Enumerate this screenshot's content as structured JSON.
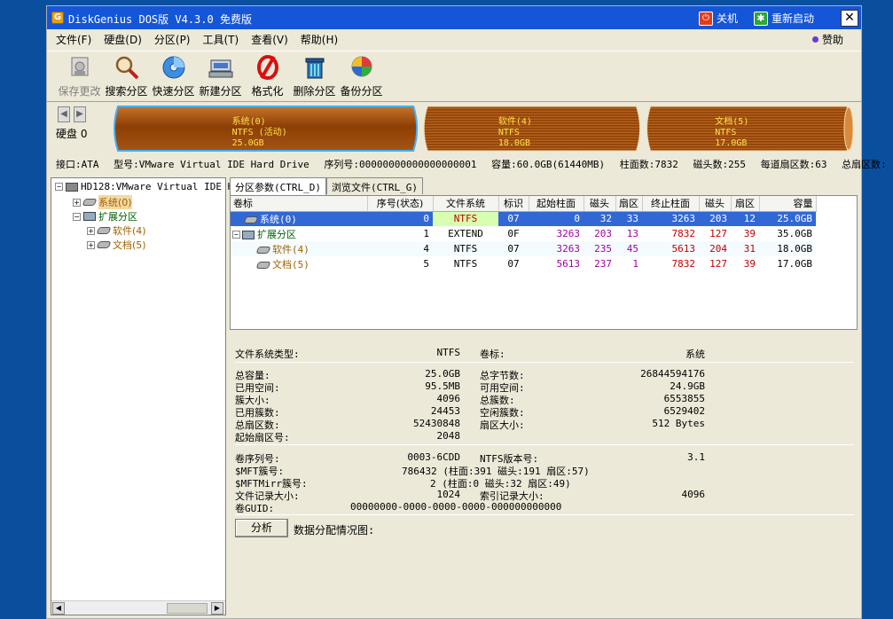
{
  "titlebar": {
    "title": "DiskGenius DOS版 V4.3.0 免费版",
    "app_icon": "G",
    "shutdown": "关机",
    "restart": "重新启动",
    "close": "✕"
  },
  "menu": [
    "文件(F)",
    "硬盘(D)",
    "分区(P)",
    "工具(T)",
    "查看(V)",
    "帮助(H)"
  ],
  "donate": "赞助",
  "toolbar": [
    {
      "label": "保存更改",
      "icon": "save-icon",
      "enabled": false
    },
    {
      "label": "搜索分区",
      "icon": "magnifier-icon",
      "enabled": true
    },
    {
      "label": "快速分区",
      "icon": "quick-partition-icon",
      "enabled": true
    },
    {
      "label": "新建分区",
      "icon": "new-partition-icon",
      "enabled": true
    },
    {
      "label": "格式化",
      "icon": "format-icon",
      "enabled": true
    },
    {
      "label": "删除分区",
      "icon": "trash-icon",
      "enabled": true
    },
    {
      "label": "备份分区",
      "icon": "backup-icon",
      "enabled": true
    }
  ],
  "disk": {
    "label": "硬盘 0",
    "partitions": [
      {
        "name": "系统(0)",
        "fs": "NTFS (活动)",
        "size": "25.0GB",
        "size_gb": 25.0
      },
      {
        "name": "软件(4)",
        "fs": "NTFS",
        "size": "18.0GB",
        "size_gb": 18.0
      },
      {
        "name": "文档(5)",
        "fs": "NTFS",
        "size": "17.0GB",
        "size_gb": 17.0
      }
    ]
  },
  "info": {
    "interface": "接口:ATA",
    "model": "型号:VMware Virtual IDE Hard Drive",
    "serial": "序列号:00000000000000000001",
    "capacity": "容量:60.0GB(61440MB)",
    "cylinders": "柱面数:7832",
    "heads": "磁头数:255",
    "sectors_per_track": "每道扇区数:63",
    "total_sectors": "总扇区数:"
  },
  "tree": {
    "root": "HD128:VMware Virtual IDE H",
    "system": "系统(0)",
    "extended": "扩展分区",
    "software": "软件(4)",
    "documents": "文档(5)"
  },
  "tabs": [
    "分区参数(CTRL_D)",
    "浏览文件(CTRL_G)"
  ],
  "table": {
    "headers": [
      "卷标",
      "序号(状态)",
      "文件系统",
      "标识",
      "起始柱面",
      "磁头",
      "扇区",
      "终止柱面",
      "磁头",
      "扇区",
      "容量"
    ],
    "rows": [
      {
        "label": "系统(0)",
        "index": "0",
        "fs": "NTFS",
        "id": "07",
        "start_cyl": "0",
        "start_head": "32",
        "start_sec": "33",
        "end_cyl": "3263",
        "end_head": "203",
        "end_sec": "12",
        "size": "25.0GB"
      },
      {
        "label": "扩展分区",
        "index": "1",
        "fs": "EXTEND",
        "id": "0F",
        "start_cyl": "3263",
        "start_head": "203",
        "start_sec": "13",
        "end_cyl": "7832",
        "end_head": "127",
        "end_sec": "39",
        "size": "35.0GB"
      },
      {
        "label": "软件(4)",
        "index": "4",
        "fs": "NTFS",
        "id": "07",
        "start_cyl": "3263",
        "start_head": "235",
        "start_sec": "45",
        "end_cyl": "5613",
        "end_head": "204",
        "end_sec": "31",
        "size": "18.0GB"
      },
      {
        "label": "文档(5)",
        "index": "5",
        "fs": "NTFS",
        "id": "07",
        "start_cyl": "5613",
        "start_head": "237",
        "start_sec": "1",
        "end_cyl": "7832",
        "end_head": "127",
        "end_sec": "39",
        "size": "17.0GB"
      }
    ]
  },
  "details": {
    "fs_type_label": "文件系统类型:",
    "fs_type": "NTFS",
    "vol_label_label": "卷标:",
    "vol_label": "系统",
    "total_label": "总容量:",
    "total": "25.0GB",
    "total_bytes_label": "总字节数:",
    "total_bytes": "26844594176",
    "used_label": "已用空间:",
    "used": "95.5MB",
    "free_label": "可用空间:",
    "free": "24.9GB",
    "cluster_size_label": "簇大小:",
    "cluster_size": "4096",
    "total_clusters_label": "总簇数:",
    "total_clusters": "6553855",
    "used_clusters_label": "已用簇数:",
    "used_clusters": "24453",
    "free_clusters_label": "空闲簇数:",
    "free_clusters": "6529402",
    "total_sectors_label": "总扇区数:",
    "total_sectors": "52430848",
    "sector_size_label": "扇区大小:",
    "sector_size": "512 Bytes",
    "start_sector_label": "起始扇区号:",
    "start_sector": "2048",
    "serial_label": "卷序列号:",
    "serial": "0003-6CDD",
    "ntfs_ver_label": "NTFS版本号:",
    "ntfs_ver": "3.1",
    "mft_label": "$MFT簇号:",
    "mft": "786432 (柱面:391 磁头:191 扇区:57)",
    "mftmirr_label": "$MFTMirr簇号:",
    "mftmirr": "2 (柱面:0 磁头:32 扇区:49)",
    "record_label": "文件记录大小:",
    "record": "1024",
    "index_label": "索引记录大小:",
    "index": "4096",
    "guid_label": "卷GUID:",
    "guid": "00000000-0000-0000-0000-000000000000",
    "analyze": "分析",
    "alloc_label": "数据分配情况图:"
  },
  "colors": {
    "desktop": "#0a4f9e",
    "titlebar": "#1556d8",
    "partition_fill": "#9c4a08",
    "partition_text": "#ffe24a",
    "selection": "#3168d5"
  }
}
